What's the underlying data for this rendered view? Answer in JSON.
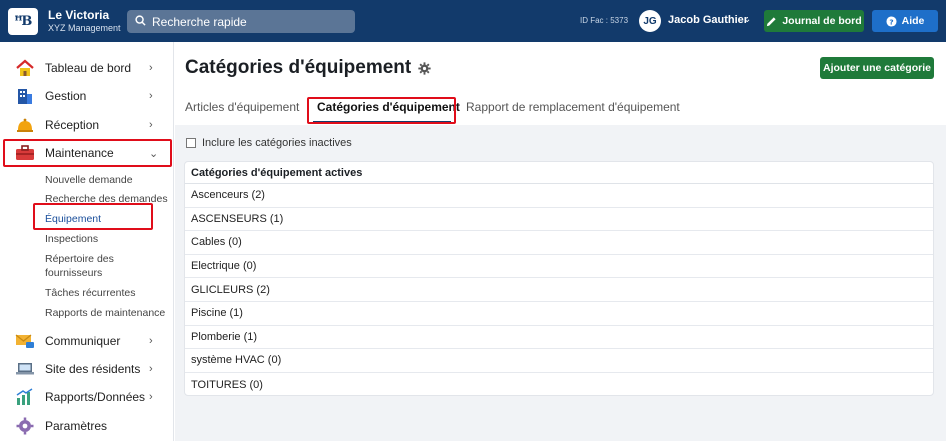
{
  "header": {
    "logo_text": "ꟸB",
    "org_name": "Le Victoria",
    "org_sub": "XYZ Management",
    "search_placeholder": "Recherche rapide",
    "id_fac": "ID Fac : 5373",
    "user_initials": "JG",
    "user_name": "Jacob Gauthier",
    "journal_label": "Journal de bord",
    "aide_label": "Aide"
  },
  "sidebar": {
    "items": [
      {
        "label": "Tableau de bord",
        "icon": "home-icon"
      },
      {
        "label": "Gestion",
        "icon": "building-icon"
      },
      {
        "label": "Réception",
        "icon": "bell-icon"
      },
      {
        "label": "Maintenance",
        "icon": "toolbox-icon"
      },
      {
        "label": "Communiquer",
        "icon": "mail-icon"
      },
      {
        "label": "Site des résidents",
        "icon": "laptop-icon"
      },
      {
        "label": "Rapports/Données",
        "icon": "chart-icon"
      },
      {
        "label": "Paramètres",
        "icon": "gear-icon"
      }
    ],
    "maintenance_sub": [
      "Nouvelle demande",
      "Recherche des demandes",
      "Équipement",
      "Inspections",
      "Répertoire des",
      "fournisseurs",
      "Tâches récurrentes",
      "Rapports de maintenance"
    ]
  },
  "main": {
    "title": "Catégories d'équipement",
    "add_button": "Ajouter une catégorie",
    "tabs": [
      {
        "label": "Articles d'équipement",
        "active": false
      },
      {
        "label": "Catégories d'équipement",
        "active": true
      },
      {
        "label": "Rapport de remplacement d'équipement",
        "active": false
      }
    ],
    "include_inactive_label": "Inclure les catégories inactives",
    "include_inactive_checked": false,
    "table_header": "Catégories d'équipement actives",
    "rows": [
      "Ascenceurs (2)",
      "ASCENSEURS (1)",
      "Cables (0)",
      "Electrique (0)",
      "GLICLEURS (2)",
      "Piscine (1)",
      "Plomberie (1)",
      "système HVAC (0)",
      "TOITURES (0)"
    ]
  },
  "colors": {
    "topbar": "#123a6b",
    "green_button": "#1f7a3a",
    "blue_button": "#1e6fc9",
    "highlight": "#e00d1a"
  }
}
